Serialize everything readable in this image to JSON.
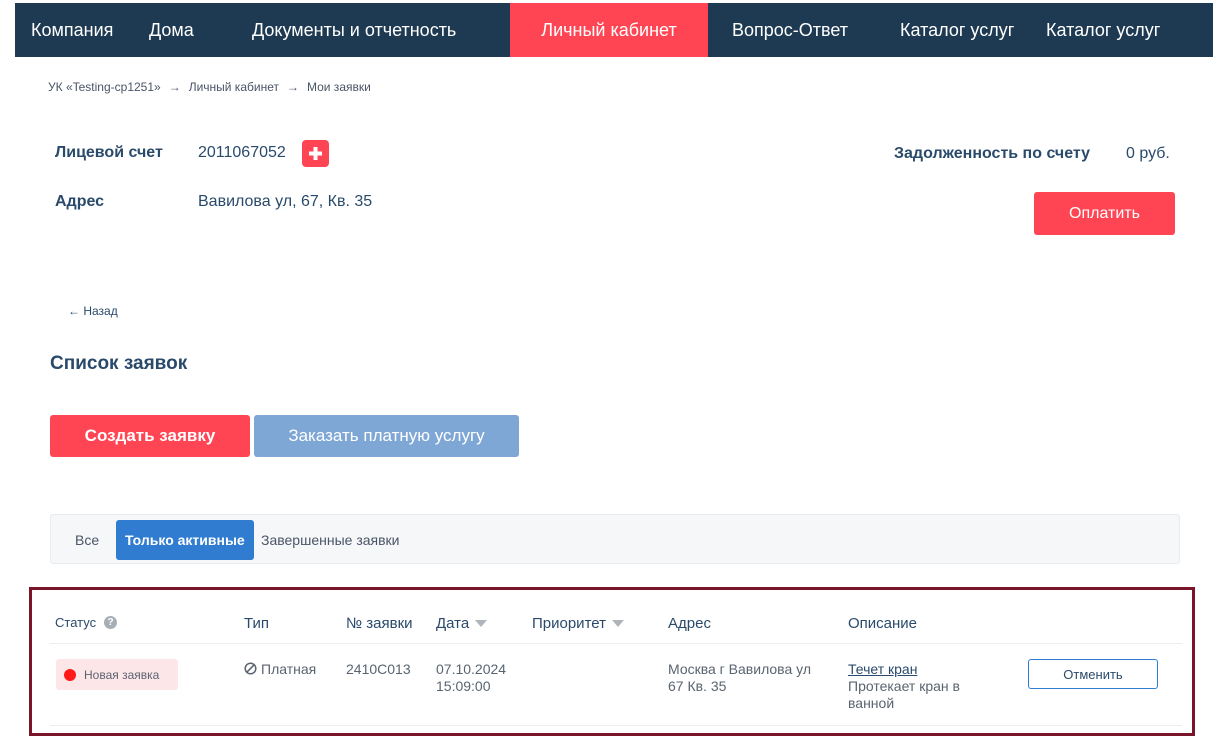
{
  "nav": {
    "items": [
      "Компания",
      "Дома",
      "Документы и отчетность",
      "Личный кабинет",
      "Вопрос-Ответ",
      "Каталог услуг",
      "Каталог услуг"
    ]
  },
  "breadcrumb": {
    "items": [
      "УК «Testing-cp1251»",
      "Личный кабинет",
      "Мои заявки"
    ],
    "separator": "→"
  },
  "account": {
    "account_label": "Лицевой счет",
    "account_number": "2011067052",
    "address_label": "Адрес",
    "address_value": "Вавилова ул, 67, Кв. 35",
    "debt_label": "Задолженность по счету",
    "debt_value": "0 руб.",
    "pay_label": "Оплатить"
  },
  "back_label": "← Назад",
  "section_title": "Список заявок",
  "actions": {
    "create_label": "Создать заявку",
    "order_label": "Заказать платную услугу"
  },
  "filters": {
    "all": "Все",
    "active": "Только активные",
    "completed": "Завершенные заявки"
  },
  "table": {
    "headers": {
      "status": "Статус",
      "type": "Тип",
      "number": "№ заявки",
      "date": "Дата",
      "priority": "Приоритет",
      "address": "Адрес",
      "description": "Описание"
    },
    "help_glyph": "?",
    "rows": [
      {
        "status": "Новая заявка",
        "type": "Платная",
        "number": "2410C013",
        "date": "07.10.2024",
        "time": "15:09:00",
        "address_line1": "Москва г Вавилова ул",
        "address_line2": "67 Кв. 35",
        "title": "Течет кран",
        "desc_line1": "Протекает кран в",
        "desc_line2": "ванной",
        "cancel_label": "Отменить"
      }
    ]
  },
  "colors": {
    "nav_bg": "#1e3a52",
    "accent_red": "#ff4553",
    "accent_blue": "#2f7cd0",
    "table_border": "#7a1428"
  }
}
